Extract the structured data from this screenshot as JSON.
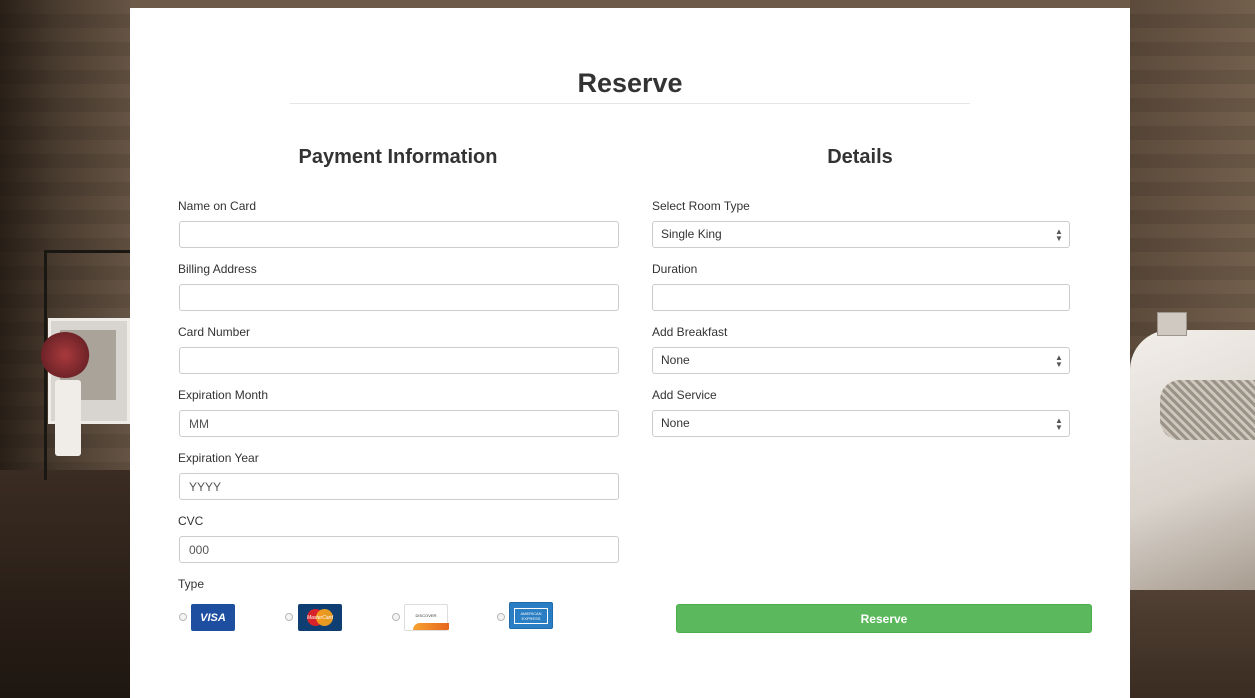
{
  "page": {
    "title": "Reserve"
  },
  "payment": {
    "heading": "Payment Information",
    "fields": [
      {
        "label": "Name on Card",
        "placeholder": "",
        "value": ""
      },
      {
        "label": "Billing Address",
        "placeholder": "",
        "value": ""
      },
      {
        "label": "Card Number",
        "placeholder": "",
        "value": ""
      },
      {
        "label": "Expiration Month",
        "placeholder": "MM",
        "value": ""
      },
      {
        "label": "Expiration Year",
        "placeholder": "YYYY",
        "value": ""
      },
      {
        "label": "CVC",
        "placeholder": "000",
        "value": ""
      }
    ],
    "type_label": "Type",
    "card_types": [
      {
        "name": "visa",
        "text": "VISA",
        "icon": "visa-card-icon"
      },
      {
        "name": "mastercard",
        "text": "MasterCard",
        "icon": "mastercard-card-icon"
      },
      {
        "name": "discover",
        "text": "DISCOVER",
        "icon": "discover-card-icon"
      },
      {
        "name": "amex",
        "text": "AMERICAN EXPRESS",
        "icon": "amex-card-icon"
      }
    ]
  },
  "details": {
    "heading": "Details",
    "room_type": {
      "label": "Select Room Type",
      "selected": "Single King"
    },
    "duration": {
      "label": "Duration",
      "placeholder": "",
      "value": ""
    },
    "breakfast": {
      "label": "Add Breakfast",
      "selected": "None"
    },
    "service": {
      "label": "Add Service",
      "selected": "None"
    },
    "select_arrow_glyph": "▲▼"
  },
  "actions": {
    "reserve_label": "Reserve"
  },
  "colors": {
    "button_green": "#5cb85c",
    "panel_bg": "#ffffff",
    "text": "#333333"
  }
}
